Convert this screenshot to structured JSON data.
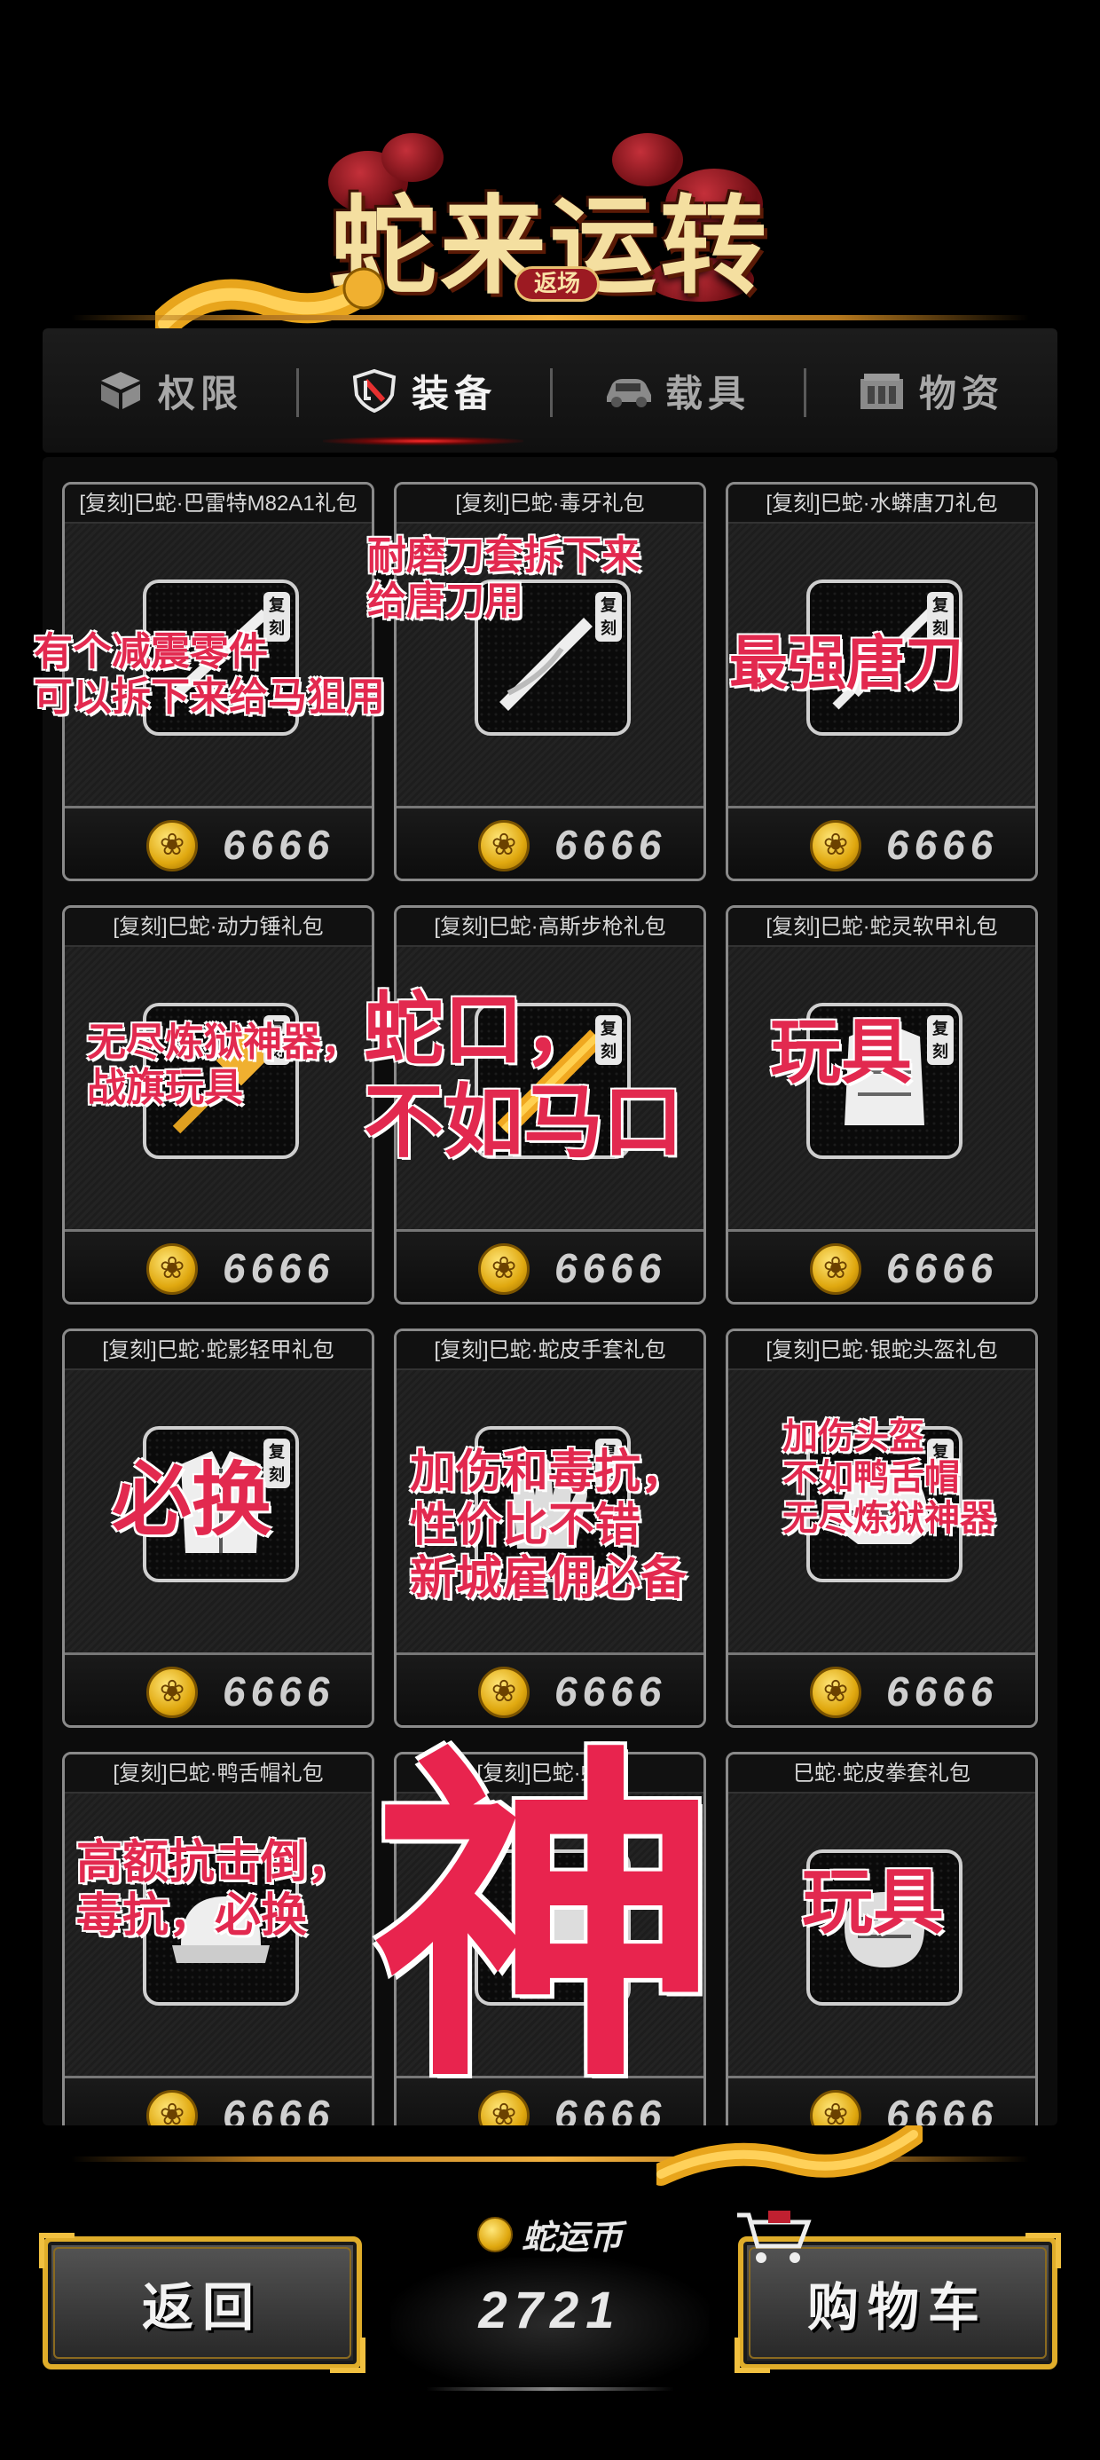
{
  "header": {
    "title": "蛇来运转",
    "badge": "返场"
  },
  "tabs": [
    {
      "label": "权限",
      "icon": "cube-icon",
      "active": false
    },
    {
      "label": "装备",
      "icon": "shield-icon",
      "active": true
    },
    {
      "label": "载具",
      "icon": "car-icon",
      "active": false
    },
    {
      "label": "物资",
      "icon": "crate-icon",
      "active": false
    }
  ],
  "items": [
    {
      "title": "[复刻]巳蛇·巴雷特M82A1礼包",
      "price": "6666",
      "tag": "复刻"
    },
    {
      "title": "[复刻]巳蛇·毒牙礼包",
      "price": "6666",
      "tag": "复刻"
    },
    {
      "title": "[复刻]巳蛇·水蟒唐刀礼包",
      "price": "6666",
      "tag": "复刻"
    },
    {
      "title": "[复刻]巳蛇·动力锤礼包",
      "price": "6666",
      "tag": "复刻"
    },
    {
      "title": "[复刻]巳蛇·高斯步枪礼包",
      "price": "6666",
      "tag": "复刻"
    },
    {
      "title": "[复刻]巳蛇·蛇灵软甲礼包",
      "price": "6666",
      "tag": "复刻"
    },
    {
      "title": "[复刻]巳蛇·蛇影轻甲礼包",
      "price": "6666",
      "tag": "复刻"
    },
    {
      "title": "[复刻]巳蛇·蛇皮手套礼包",
      "price": "6666",
      "tag": "复刻"
    },
    {
      "title": "[复刻]巳蛇·银蛇头盔礼包",
      "price": "6666",
      "tag": "复刻"
    },
    {
      "title": "[复刻]巳蛇·鸭舌帽礼包",
      "price": "6666",
      "tag": ""
    },
    {
      "title": "[复刻]巳蛇·蛇皮",
      "price": "6666",
      "tag": ""
    },
    {
      "title": "巳蛇·蛇皮拳套礼包",
      "price": "6666",
      "tag": ""
    }
  ],
  "annotations": {
    "a1_l1": "有个减震零件",
    "a1_l2": "可以拆下来给马狙用",
    "a2_l1": "耐磨刀套拆下来",
    "a2_l2": "给唐刀用",
    "a3": "最强唐刀",
    "a4_l1": "无尽炼狱神器，",
    "a4_l2": "战旗玩具",
    "a5_l1": "蛇口，",
    "a5_l2": "不如马口",
    "a6": "玩具",
    "a7": "必换",
    "a8_l1": "加伤和毒抗，",
    "a8_l2": "性价比不错",
    "a8_l3": "新城雇佣必备",
    "a9_l1": "加伤头盔",
    "a9_l2": "不如鸭舌帽",
    "a9_l3": "无尽炼狱神器",
    "a10_l1": "高额抗击倒，",
    "a10_l2": "毒抗，必换",
    "a11": "神",
    "a12": "玩具"
  },
  "footer": {
    "back_label": "返回",
    "currency_label": "蛇运币",
    "currency_value": "2721",
    "cart_label": "购物车"
  },
  "colors": {
    "accent_gold": "#e0ad2a",
    "annotation_red": "#e2294f",
    "tab_active_glow": "#ff2a2a"
  }
}
